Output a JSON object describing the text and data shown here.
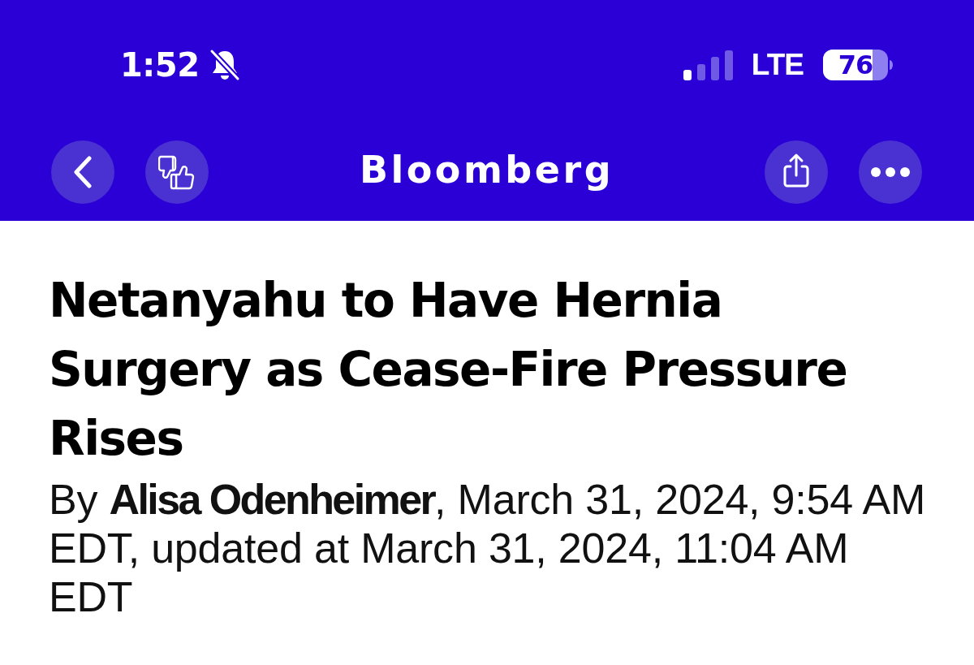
{
  "status_bar": {
    "time": "1:52",
    "silent_mode": true,
    "network": "LTE",
    "battery": "76"
  },
  "nav_bar": {
    "logo": "Bloomberg"
  },
  "article": {
    "headline": "Netanyahu to Have Hernia Surgery as Cease-Fire Pressure Rises",
    "byline": "By **Alisa Odenheimer**, March 31, 2024, 9:54 AM EDT, updated at March 31, 2024, 11:04 AM EDT"
  }
}
